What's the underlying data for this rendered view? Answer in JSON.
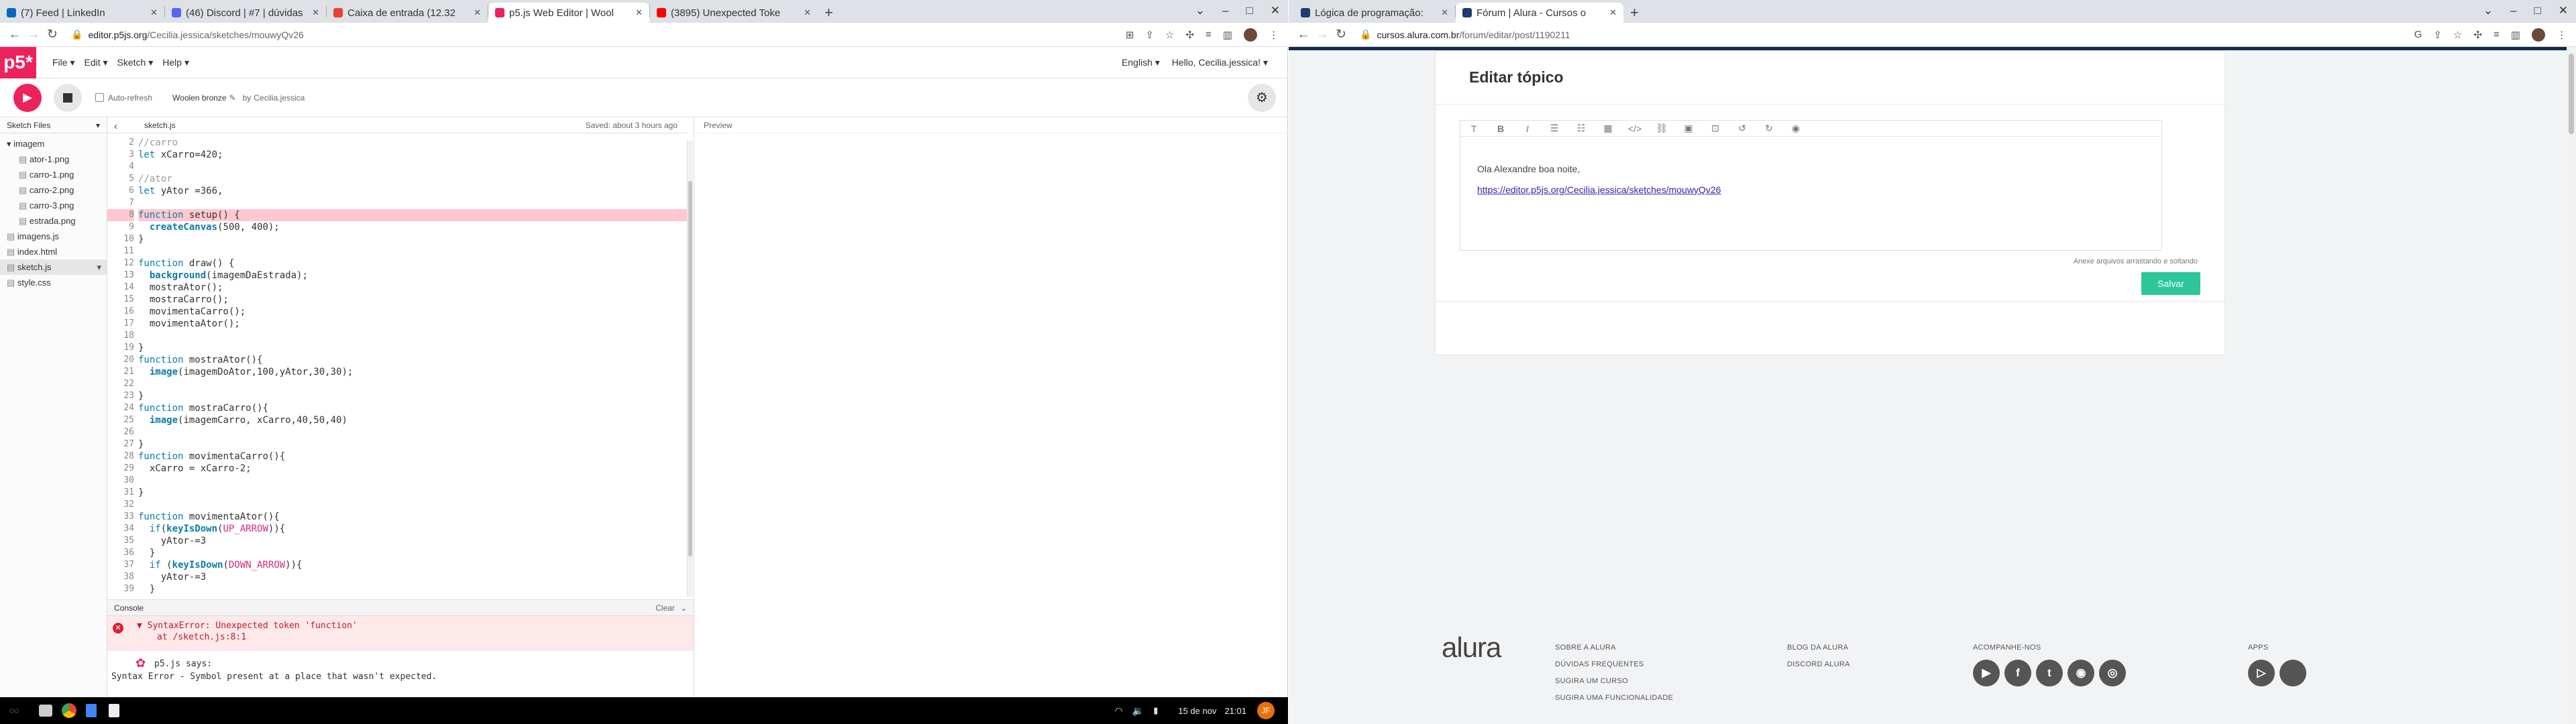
{
  "left_window": {
    "tabs": [
      {
        "title": "(7) Feed | LinkedIn",
        "color": "#0a66c2"
      },
      {
        "title": "(46) Discord | #7 | dúvidas",
        "color": "#5865f2"
      },
      {
        "title": "Caixa de entrada (12.32",
        "color": "#ea4335"
      },
      {
        "title": "p5.js Web Editor | Wool",
        "color": "#ed225d",
        "active": true
      },
      {
        "title": "(3895) Unexpected Toke",
        "color": "#ff0000"
      }
    ],
    "url": {
      "host": "editor.p5js.org",
      "path": "/Cecilia.jessica/sketches/mouwyQv26"
    },
    "p5": {
      "logo": "p5*",
      "menu": [
        "File",
        "Edit",
        "Sketch",
        "Help"
      ],
      "language": "English",
      "user": "Hello, Cecilia.jessica!",
      "auto_refresh": "Auto-refresh",
      "sketch_name": "Woolen bronze",
      "by": "by",
      "owner": "Cecilia.jessica",
      "sidebar_title": "Sketch Files",
      "folder": "imagem",
      "images": [
        "ator-1.png",
        "carro-1.png",
        "carro-2.png",
        "carro-3.png",
        "estrada.png"
      ],
      "files": [
        "imagens.js",
        "index.html",
        "sketch.js",
        "style.css"
      ],
      "tab_file": "sketch.js",
      "saved": "Saved: about 3 hours ago",
      "preview": "Preview",
      "console_title": "Console",
      "clear": "Clear",
      "error": "SyntaxError: Unexpected token 'function'",
      "error_loc": "at /sketch.js:8:1",
      "p5_says": "p5.js says:",
      "p5_msg": "Syntax Error - Symbol present at a place that wasn't expected."
    },
    "code": [
      {
        "n": "2",
        "html": "<span class='cm'>//carro</span>"
      },
      {
        "n": "3",
        "html": "<span class='kw'>let</span> xCarro=420;"
      },
      {
        "n": "4",
        "html": ""
      },
      {
        "n": "5",
        "html": "<span class='cm'>//ator</span>"
      },
      {
        "n": "6",
        "html": "<span class='kw'>let</span> yAtor =366,"
      },
      {
        "n": "7",
        "html": ""
      },
      {
        "n": "8",
        "html": "<span class='kw'>function</span> setup() {",
        "err": true
      },
      {
        "n": "9",
        "html": "  <span class='fn'>createCanvas</span>(500, 400);"
      },
      {
        "n": "10",
        "html": "}"
      },
      {
        "n": "11",
        "html": ""
      },
      {
        "n": "12",
        "html": "<span class='kw'>function</span> draw() {"
      },
      {
        "n": "13",
        "html": "  <span class='fn'>background</span>(imagemDaEstrada);"
      },
      {
        "n": "14",
        "html": "  mostraAtor();"
      },
      {
        "n": "15",
        "html": "  mostraCarro();"
      },
      {
        "n": "16",
        "html": "  movimentaCarro();"
      },
      {
        "n": "17",
        "html": "  movimentaAtor();"
      },
      {
        "n": "18",
        "html": ""
      },
      {
        "n": "19",
        "html": "}"
      },
      {
        "n": "20",
        "html": "<span class='kw'>function</span> mostraAtor(){"
      },
      {
        "n": "21",
        "html": "  <span class='fn'>image</span>(imagemDoAtor,100,yAtor,30,30);"
      },
      {
        "n": "22",
        "html": ""
      },
      {
        "n": "23",
        "html": "}"
      },
      {
        "n": "24",
        "html": "<span class='kw'>function</span> mostraCarro(){"
      },
      {
        "n": "25",
        "html": "  <span class='fn'>image</span>(imagemCarro, xCarro,40,50,40)"
      },
      {
        "n": "26",
        "html": ""
      },
      {
        "n": "27",
        "html": "}"
      },
      {
        "n": "28",
        "html": "<span class='kw'>function</span> movimentaCarro(){"
      },
      {
        "n": "29",
        "html": "  xCarro = xCarro-2;"
      },
      {
        "n": "30",
        "html": ""
      },
      {
        "n": "31",
        "html": "}"
      },
      {
        "n": "32",
        "html": ""
      },
      {
        "n": "33",
        "html": "<span class='kw'>function</span> movimentaAtor(){"
      },
      {
        "n": "34",
        "html": "  <span class='kw'>if</span>(<span class='fn'>keyIsDown</span>(<span class='pk'>UP_ARROW</span>)){"
      },
      {
        "n": "35",
        "html": "    yAtor-=3"
      },
      {
        "n": "36",
        "html": "  }"
      },
      {
        "n": "37",
        "html": "  <span class='kw'>if</span> (<span class='fn'>keyIsDown</span>(<span class='pk'>DOWN_ARROW</span>)){"
      },
      {
        "n": "38",
        "html": "    yAtor-=3"
      },
      {
        "n": "39",
        "html": "  }"
      }
    ]
  },
  "right_window": {
    "tabs": [
      {
        "title": "Lógica de programação:",
        "color": "#1c3d6e"
      },
      {
        "title": "Fórum | Alura - Cursos o",
        "color": "#1c3d6e",
        "active": true
      }
    ],
    "url": {
      "host": "cursos.alura.com.br",
      "path": "/forum/editar/post/1190211"
    },
    "page_title": "Editar tópico",
    "content_line1": "Ola Alexandre boa noite,",
    "content_link": "https://editor.p5js.org/Cecilia.jessica/sketches/mouwyQv26",
    "attach_hint": "Anexe arquivos arrastando e soltando",
    "save_button": "Salvar",
    "footer": {
      "logo": "alura",
      "col1": [
        "SOBRE A ALURA",
        "DÚVIDAS FREQUENTES",
        "SUGIRA UM CURSO",
        "SUGIRA UMA FUNCIONALIDADE"
      ],
      "col2": [
        "BLOG DA ALURA",
        "DISCORD ALURA"
      ],
      "follow": "ACOMPANHE-NOS",
      "apps": "APPS"
    },
    "accent": "#2bc69a"
  },
  "taskbar": {
    "date": "15 de nov",
    "time": "21:01",
    "user_initials": "JF"
  }
}
